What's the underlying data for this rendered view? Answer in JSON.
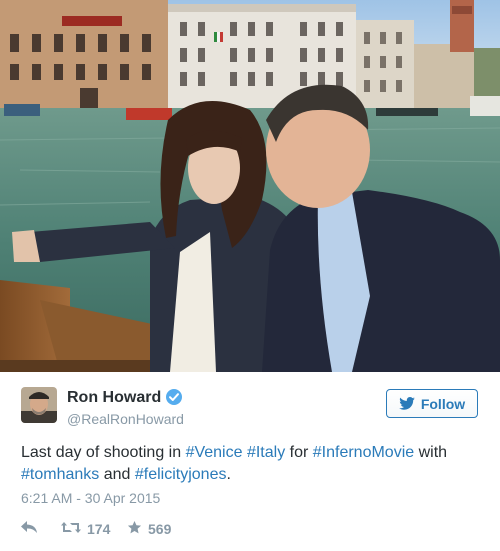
{
  "author": {
    "display_name": "Ron Howard",
    "handle": "@RealRonHoward",
    "verified": true
  },
  "follow_button": {
    "label": "Follow"
  },
  "tweet": {
    "text_segments": [
      {
        "type": "text",
        "value": "Last day of shooting in "
      },
      {
        "type": "link",
        "value": "#Venice"
      },
      {
        "type": "text",
        "value": " "
      },
      {
        "type": "link",
        "value": "#Italy"
      },
      {
        "type": "text",
        "value": " for "
      },
      {
        "type": "link",
        "value": "#InfernoMovie"
      },
      {
        "type": "text",
        "value": " with "
      },
      {
        "type": "link",
        "value": "#tomhanks"
      },
      {
        "type": "text",
        "value": " and "
      },
      {
        "type": "link",
        "value": "#felicityjones"
      },
      {
        "type": "text",
        "value": "."
      }
    ],
    "timestamp": "6:21 AM - 30 Apr 2015"
  },
  "actions": {
    "reply_icon": "reply-icon",
    "retweet_icon": "retweet-icon",
    "retweet_count": "174",
    "like_icon": "star-icon",
    "like_count": "569"
  },
  "colors": {
    "link": "#2b7bb9",
    "text": "#292f33",
    "muted": "#8899a6",
    "verified": "#55acee"
  }
}
